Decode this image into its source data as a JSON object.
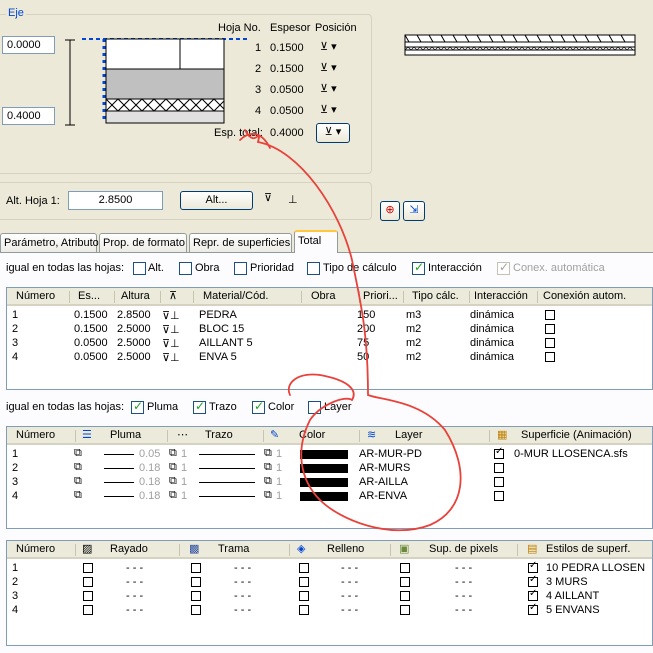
{
  "eje": {
    "title": "Eje",
    "top_value": "0.0000",
    "bottom_value": "0.4000",
    "col_hoja": "Hoja No.",
    "col_espesor": "Espesor",
    "col_posicion": "Posición",
    "rows": [
      {
        "num": "1",
        "esp": "0.1500"
      },
      {
        "num": "2",
        "esp": "0.1500"
      },
      {
        "num": "3",
        "esp": "0.0500"
      },
      {
        "num": "4",
        "esp": "0.0500"
      }
    ],
    "total_label": "Esp. total:",
    "total_value": "0.4000"
  },
  "alt": {
    "label": "Alt. Hoja 1:",
    "value": "2.8500",
    "button": "Alt..."
  },
  "tabs": [
    "Parámetro, Atributo",
    "Prop. de formato",
    "Repr. de superficies",
    "Total"
  ],
  "section1": {
    "label": "igual en todas las hojas:",
    "checks": [
      {
        "label": "Alt.",
        "checked": false
      },
      {
        "label": "Obra",
        "checked": false
      },
      {
        "label": "Prioridad",
        "checked": false
      },
      {
        "label": "Tipo de cálculo",
        "checked": false
      },
      {
        "label": "Interacción",
        "checked": true
      },
      {
        "label": "Conex. automática",
        "checked": true,
        "disabled": true
      }
    ],
    "headers": [
      "Número",
      "Es...",
      "Altura",
      "Material/Cód.",
      "Obra",
      "Priori...",
      "Tipo cálc.",
      "Interacción",
      "Conexión autom."
    ],
    "rows": [
      {
        "num": "1",
        "es": "0.1500",
        "alt": "2.8500",
        "mat": "PEDRA",
        "pri": "150",
        "tipo": "m3",
        "inter": "dinámica"
      },
      {
        "num": "2",
        "es": "0.1500",
        "alt": "2.5000",
        "mat": "BLOC 15",
        "pri": "200",
        "tipo": "m2",
        "inter": "dinámica"
      },
      {
        "num": "3",
        "es": "0.0500",
        "alt": "2.5000",
        "mat": "AILLANT 5",
        "pri": "75",
        "tipo": "m2",
        "inter": "dinámica"
      },
      {
        "num": "4",
        "es": "0.0500",
        "alt": "2.5000",
        "mat": "ENVA 5",
        "pri": "50",
        "tipo": "m2",
        "inter": "dinámica"
      }
    ]
  },
  "section2": {
    "label": "igual en todas las hojas:",
    "checks": [
      {
        "label": "Pluma",
        "checked": true
      },
      {
        "label": "Trazo",
        "checked": true
      },
      {
        "label": "Color",
        "checked": true
      },
      {
        "label": "Layer",
        "checked": false
      }
    ],
    "headers": [
      "Número",
      "Pluma",
      "Trazo",
      "Color",
      "Layer",
      "Superficie (Animación)"
    ],
    "rows": [
      {
        "num": "1",
        "pluma": "0.05",
        "trazo": "1",
        "color": "1",
        "layer": "AR-MUR-PD",
        "sup_checked": true,
        "sup": "0-MUR LLOSENCA.sfs"
      },
      {
        "num": "2",
        "pluma": "0.18",
        "trazo": "1",
        "color": "1",
        "layer": "AR-MURS",
        "sup_checked": false,
        "sup": ""
      },
      {
        "num": "3",
        "pluma": "0.18",
        "trazo": "1",
        "color": "1",
        "layer": "AR-AILLA",
        "sup_checked": false,
        "sup": ""
      },
      {
        "num": "4",
        "pluma": "0.18",
        "trazo": "1",
        "color": "1",
        "layer": "AR-ENVA",
        "sup_checked": false,
        "sup": ""
      }
    ]
  },
  "section3": {
    "headers": [
      "Número",
      "Rayado",
      "Trama",
      "Relleno",
      "Sup. de pixels",
      "Estilos de superf."
    ],
    "dash": "- - -",
    "rows": [
      {
        "num": "1",
        "estilo": "10 PEDRA LLOSEN"
      },
      {
        "num": "2",
        "estilo": "3 MURS"
      },
      {
        "num": "3",
        "estilo": "4 AILLANT"
      },
      {
        "num": "4",
        "estilo": "5 ENVANS"
      }
    ]
  },
  "colors": {
    "annotation": "#e8423a",
    "selection": "#0046d5"
  }
}
